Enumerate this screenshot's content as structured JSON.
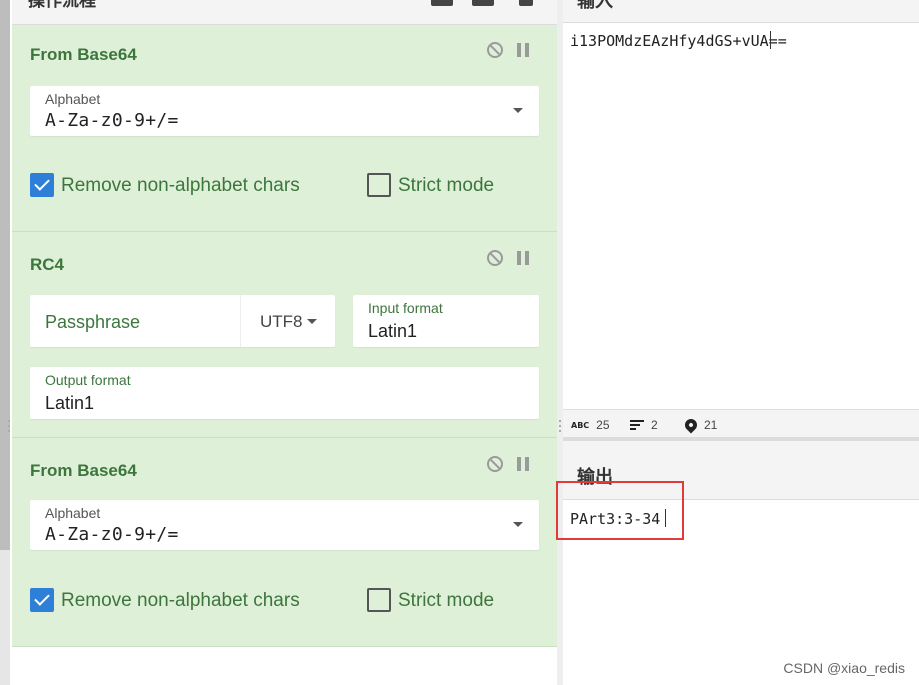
{
  "recipe": {
    "title": "操作流程",
    "operations": [
      {
        "name": "From Base64",
        "alphabet_label": "Alphabet",
        "alphabet_value": "A-Za-z0-9+/=",
        "remove_label": "Remove non-alphabet chars",
        "remove_checked": true,
        "strict_label": "Strict mode",
        "strict_checked": false
      },
      {
        "name": "RC4",
        "passphrase_placeholder": "Passphrase",
        "passphrase_encoding": "UTF8",
        "input_format_label": "Input format",
        "input_format_value": "Latin1",
        "output_format_label": "Output format",
        "output_format_value": "Latin1"
      },
      {
        "name": "From Base64",
        "alphabet_label": "Alphabet",
        "alphabet_value": "A-Za-z0-9+/=",
        "remove_label": "Remove non-alphabet chars",
        "remove_checked": true,
        "strict_label": "Strict mode",
        "strict_checked": false
      }
    ]
  },
  "input": {
    "title": "输入",
    "text": "i13POMdzEAzHfy4dGS+vUA==",
    "status": {
      "length": "25",
      "lines": "2",
      "position": "21"
    }
  },
  "output": {
    "title": "输出",
    "text": "PArt3:3-34"
  },
  "watermark": "CSDN @xiao_redis",
  "colors": {
    "op_bg": "#dff0d8",
    "op_text": "#3c763d",
    "checkbox": "#2e7fd8",
    "highlight": "#e03a3a"
  },
  "icons": [
    "disable-icon",
    "pause-icon",
    "abc-icon",
    "lines-icon",
    "position-pin-icon",
    "chevron-down-icon",
    "checkmark-icon"
  ]
}
